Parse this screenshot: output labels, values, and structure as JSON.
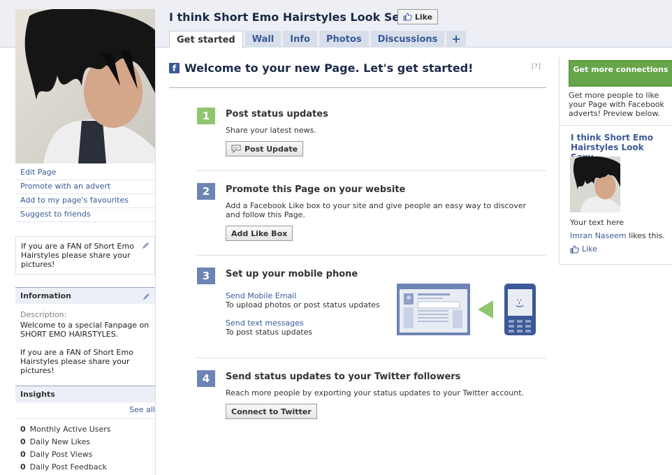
{
  "page": {
    "title": "I think Short Emo Hairstyles Look Sexy",
    "like_label": "Like"
  },
  "tabs": [
    {
      "label": "Get started",
      "active": true
    },
    {
      "label": "Wall"
    },
    {
      "label": "Info"
    },
    {
      "label": "Photos"
    },
    {
      "label": "Discussions"
    },
    {
      "label": "+"
    }
  ],
  "sidebar": {
    "links": [
      "Edit Page",
      "Promote with an advert",
      "Add to my page's favourites",
      "Suggest to friends"
    ],
    "fan_text": "If you are a FAN of Short Emo Hairstyles please share your pictures!",
    "information": {
      "heading": "Information",
      "description_label": "Description:",
      "description_1": "Welcome to a special Fanpage on SHORT EMO HAIRSTYLES.",
      "description_2": "If you are a FAN of Short Emo Hairstyles please share your pictures!"
    },
    "insights": {
      "heading": "Insights",
      "see_all": "See all",
      "metrics": [
        {
          "value": "0",
          "label": "Monthly Active Users"
        },
        {
          "value": "0",
          "label": "Daily New Likes"
        },
        {
          "value": "0",
          "label": "Daily Post Views"
        },
        {
          "value": "0",
          "label": "Daily Post Feedback"
        }
      ]
    }
  },
  "main": {
    "welcome": "Welcome to your new Page. Let's get started!",
    "help": "[?]",
    "steps": [
      {
        "num": "1",
        "title": "Post status updates",
        "desc": "Share your latest news.",
        "button": "Post Update"
      },
      {
        "num": "2",
        "title": "Promote this Page on your website",
        "desc": "Add a Facebook Like box to your site and give people an easy way to discover and follow this Page.",
        "button": "Add Like Box"
      },
      {
        "num": "3",
        "title": "Set up your mobile phone",
        "link1": "Send Mobile Email",
        "desc1": "To upload photos or post status updates",
        "link2": "Send text messages",
        "desc2": "To post status updates",
        "phone_face": ":-)"
      },
      {
        "num": "4",
        "title": "Send status updates to your Twitter followers",
        "desc": "Reach more people by exporting your status updates to your Twitter account.",
        "button": "Connect to Twitter"
      }
    ]
  },
  "ad": {
    "button": "Get more connections",
    "text": "Get more people to like your Page with Facebook adverts! Preview below.",
    "title": "I think Short Emo Hairstyles Look Sexy",
    "your_text": "Your text here",
    "liker": "Imran Naseem",
    "likes_suffix": " likes this.",
    "like": "Like"
  }
}
